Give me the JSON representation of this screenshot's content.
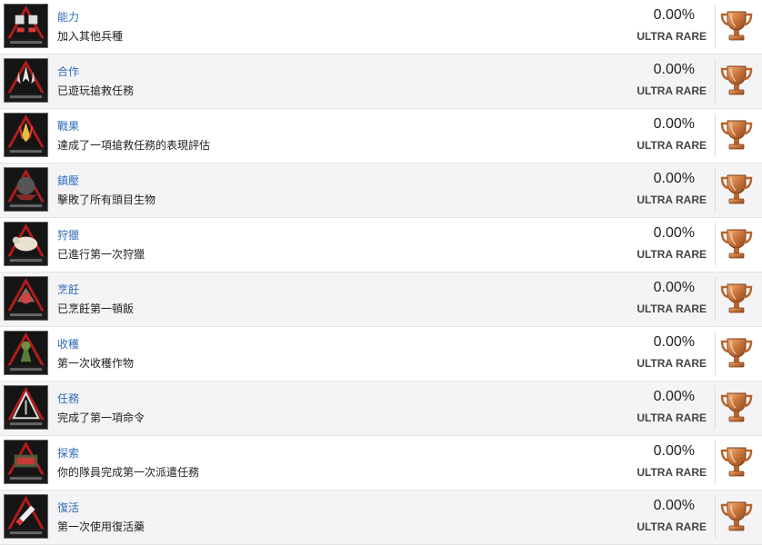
{
  "colors": {
    "title_link": "#2f6db8",
    "row_alt": "#f4f4f6",
    "trophy_bronze": "#c7733a"
  },
  "achievements": [
    {
      "title": "能力",
      "description": "加入其他兵種",
      "percent": "0.00%",
      "rarity": "ULTRA RARE",
      "trophy": "bronze-trophy-icon"
    },
    {
      "title": "合作",
      "description": "已遊玩搶救任務",
      "percent": "0.00%",
      "rarity": "ULTRA RARE",
      "trophy": "bronze-trophy-icon"
    },
    {
      "title": "戰果",
      "description": "達成了一項搶救任務的表現評估",
      "percent": "0.00%",
      "rarity": "ULTRA RARE",
      "trophy": "bronze-trophy-icon"
    },
    {
      "title": "鎮壓",
      "description": "擊敗了所有頭目生物",
      "percent": "0.00%",
      "rarity": "ULTRA RARE",
      "trophy": "bronze-trophy-icon"
    },
    {
      "title": "狩獵",
      "description": "已進行第一次狩獵",
      "percent": "0.00%",
      "rarity": "ULTRA RARE",
      "trophy": "bronze-trophy-icon"
    },
    {
      "title": "烹飪",
      "description": "已烹飪第一頓飯",
      "percent": "0.00%",
      "rarity": "ULTRA RARE",
      "trophy": "bronze-trophy-icon"
    },
    {
      "title": "收穫",
      "description": "第一次收穫作物",
      "percent": "0.00%",
      "rarity": "ULTRA RARE",
      "trophy": "bronze-trophy-icon"
    },
    {
      "title": "任務",
      "description": "完成了第一項命令",
      "percent": "0.00%",
      "rarity": "ULTRA RARE",
      "trophy": "bronze-trophy-icon"
    },
    {
      "title": "探索",
      "description": "你的隊員完成第一次派遣任務",
      "percent": "0.00%",
      "rarity": "ULTRA RARE",
      "trophy": "bronze-trophy-icon"
    },
    {
      "title": "復活",
      "description": "第一次使用復活藥",
      "percent": "0.00%",
      "rarity": "ULTRA RARE",
      "trophy": "bronze-trophy-icon"
    }
  ]
}
